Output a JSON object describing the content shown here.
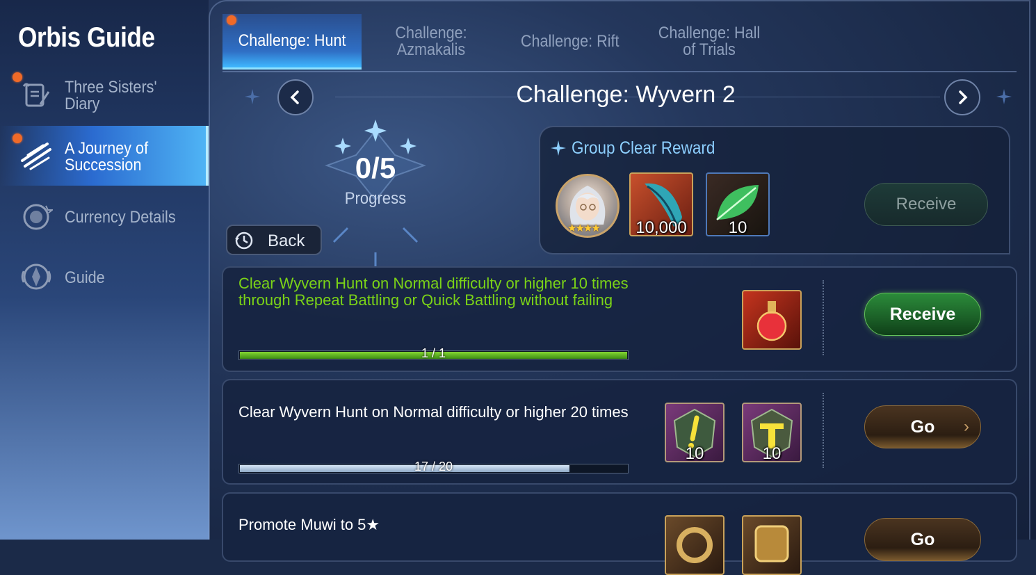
{
  "sidebar": {
    "title": "Orbis Guide",
    "items": [
      {
        "label": "Three Sisters' Diary",
        "icon": "scroll-quill-icon",
        "notify": true
      },
      {
        "label": "A Journey of Succession",
        "icon": "claw-slash-icon",
        "notify": true,
        "active": true
      },
      {
        "label": "Currency Details",
        "icon": "coin-icon",
        "notify": false
      },
      {
        "label": "Guide",
        "icon": "compass-icon",
        "notify": false
      }
    ]
  },
  "tabs": [
    {
      "label": "Challenge: Hunt",
      "active": true,
      "notify": true
    },
    {
      "label": "Challenge: Azmakalis",
      "active": false
    },
    {
      "label": "Challenge: Rift",
      "active": false
    },
    {
      "label": "Challenge: Hall of Trials",
      "active": false
    }
  ],
  "stage": {
    "title": "Challenge: Wyvern 2",
    "progress_value": "0/5",
    "progress_label": "Progress",
    "back_label": "Back"
  },
  "group_reward": {
    "title": "Group Clear Reward",
    "items": [
      {
        "icon": "hero-portrait-icon",
        "stars": 4,
        "qty": ""
      },
      {
        "icon": "blue-feather-icon",
        "qty": "10,000"
      },
      {
        "icon": "green-leaf-icon",
        "qty": "10"
      }
    ],
    "button_label": "Receive"
  },
  "missions": [
    {
      "text_line1": "Clear Wyvern Hunt on Normal difficulty or higher 10 times",
      "text_line2": "through Repeat Battling or Quick Battling without failing",
      "progress_text": "1 / 1",
      "progress": 1.0,
      "rewards": [
        {
          "icon": "red-potion-icon",
          "qty": ""
        }
      ],
      "button_label": "Receive",
      "completed": true
    },
    {
      "text_line1": "Clear Wyvern Hunt on Normal difficulty or higher 20 times",
      "text_line2": "",
      "progress_text": "17 / 20",
      "progress": 0.85,
      "rewards": [
        {
          "icon": "exclamation-gem-icon",
          "qty": "10"
        },
        {
          "icon": "hammer-gem-icon",
          "qty": "10"
        }
      ],
      "button_label": "Go",
      "completed": false
    },
    {
      "text_line1": "Promote Muwi to 5★",
      "text_line2": "",
      "rewards": [
        {
          "icon": "gold-ring-icon",
          "qty": ""
        },
        {
          "icon": "gold-barrel-icon",
          "qty": ""
        }
      ],
      "button_label": "Go"
    }
  ],
  "colors": {
    "accent_blue": "#4fb4f5",
    "complete_green": "#7bd317",
    "notify_orange": "#f06a28"
  }
}
